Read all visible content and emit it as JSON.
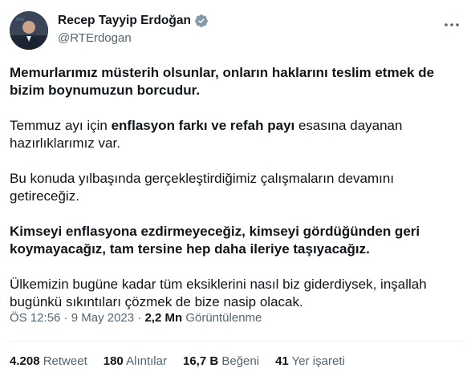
{
  "author": {
    "display_name": "Recep Tayyip Erdoğan",
    "handle": "@RTErdogan",
    "verified_color": "#829aab"
  },
  "tweet": {
    "p1": "Memurlarımız müsterih olsunlar, onların haklarını teslim etmek de bizim boynumuzun borcudur.",
    "p2_a": "Temmuz ayı için ",
    "p2_b": "enflasyon farkı ve refah payı",
    "p2_c": " esasına dayanan hazırlıklarımız var.",
    "p3": "Bu konuda yılbaşında gerçekleştirdiğimiz çalışmaların devamını getireceğiz.",
    "p4": "Kimseyi enflasyona ezdirmeyeceğiz, kimseyi gördüğünden geri koymayacağız, tam tersine hep daha ileriye taşıyacağız.",
    "p5": "Ülkemizin bugüne kadar tüm eksiklerini nasıl biz giderdiysek, inşallah bugünkü sıkıntıları çözmek de bize nasip olacak."
  },
  "meta": {
    "time": "ÖS 12:56",
    "separator": " · ",
    "date": "9 May 2023",
    "views_count": "2,2 Mn",
    "views_label": "Görüntülenme"
  },
  "stats": [
    {
      "count": "4.208",
      "label": "Retweet"
    },
    {
      "count": "180",
      "label": "Alıntılar"
    },
    {
      "count": "16,7 B",
      "label": "Beğeni"
    },
    {
      "count": "41",
      "label": "Yer işareti"
    }
  ],
  "colors": {
    "text": "#0f1419",
    "secondary": "#536471",
    "divider": "#eff3f4"
  },
  "icons": {
    "verified": "verified-badge-icon",
    "more": "more-options-icon"
  }
}
